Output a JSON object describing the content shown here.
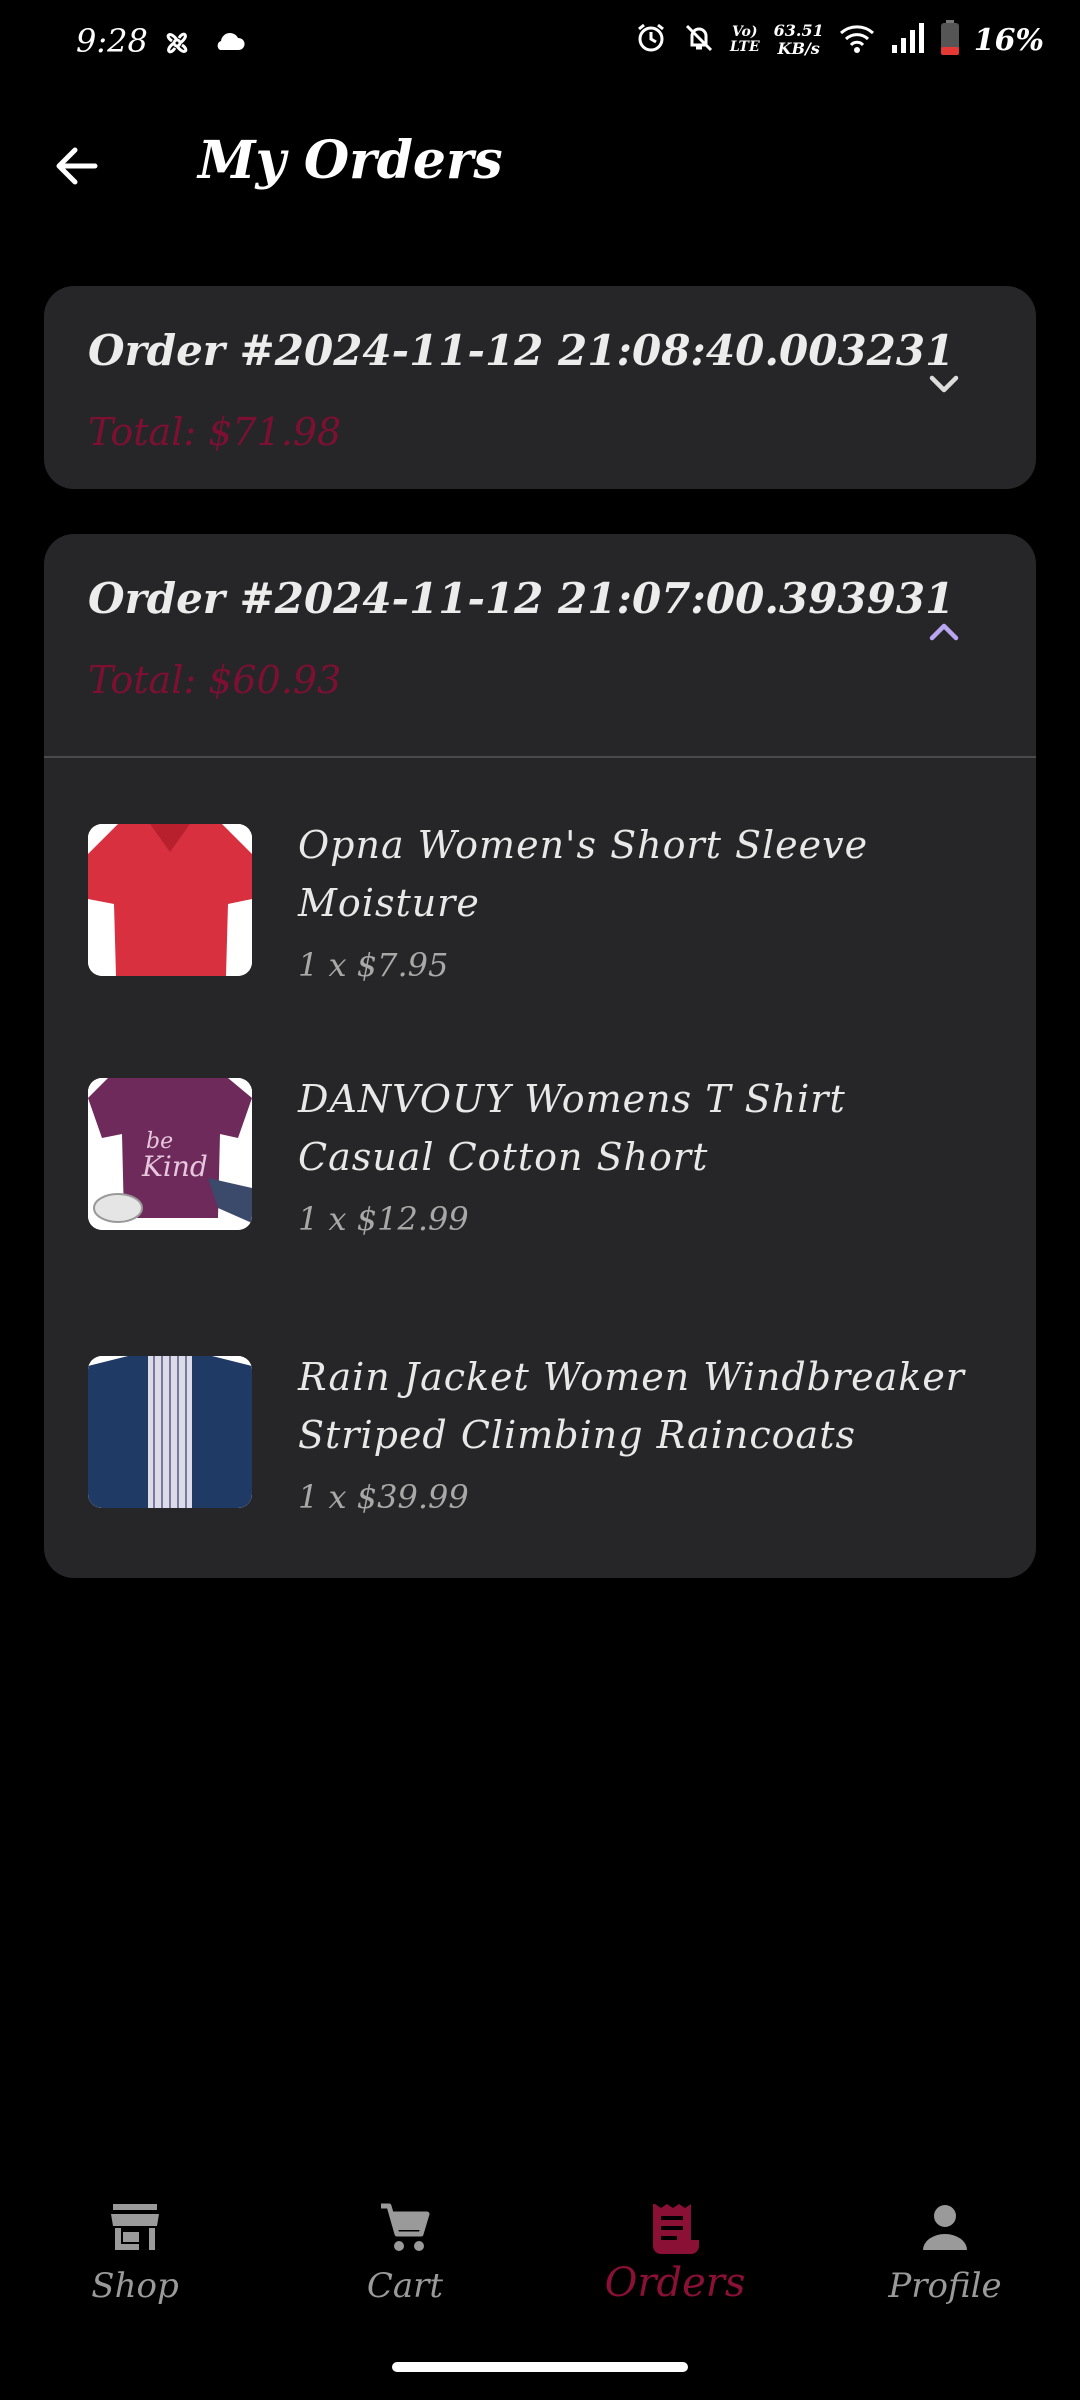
{
  "status_bar": {
    "time": "9:28",
    "net_speed_value": "63.51",
    "net_speed_unit": "KB/s",
    "volte_top": "Vo)",
    "volte_bottom": "LTE",
    "battery": "16%",
    "battery_color": "#e53935"
  },
  "header": {
    "title": "My Orders"
  },
  "orders": [
    {
      "title": "Order #2024-11-12 21:08:40.003231",
      "total": "Total: $71.98",
      "expanded": false
    },
    {
      "title": "Order #2024-11-12 21:07:00.393931",
      "total": "Total: $60.93",
      "expanded": true,
      "items": [
        {
          "name": "Opna Women's Short Sleeve Moisture",
          "qty": "1 x $7.95"
        },
        {
          "name": "DANVOUY Womens T Shirt Casual Cotton Short",
          "qty": "1 x $12.99"
        },
        {
          "name": "Rain Jacket Women Windbreaker Striped Climbing Raincoats",
          "qty": "1 x $39.99"
        }
      ]
    }
  ],
  "nav": {
    "items": [
      {
        "label": "Shop",
        "icon": "store-icon"
      },
      {
        "label": "Cart",
        "icon": "cart-icon"
      },
      {
        "label": "Orders",
        "icon": "receipt-icon",
        "active": true
      },
      {
        "label": "Profile",
        "icon": "person-icon"
      }
    ]
  },
  "colors": {
    "accent": "#8a1036",
    "total": "#7d1032",
    "card": "#262628",
    "chevron_active": "#b9a6f0"
  }
}
